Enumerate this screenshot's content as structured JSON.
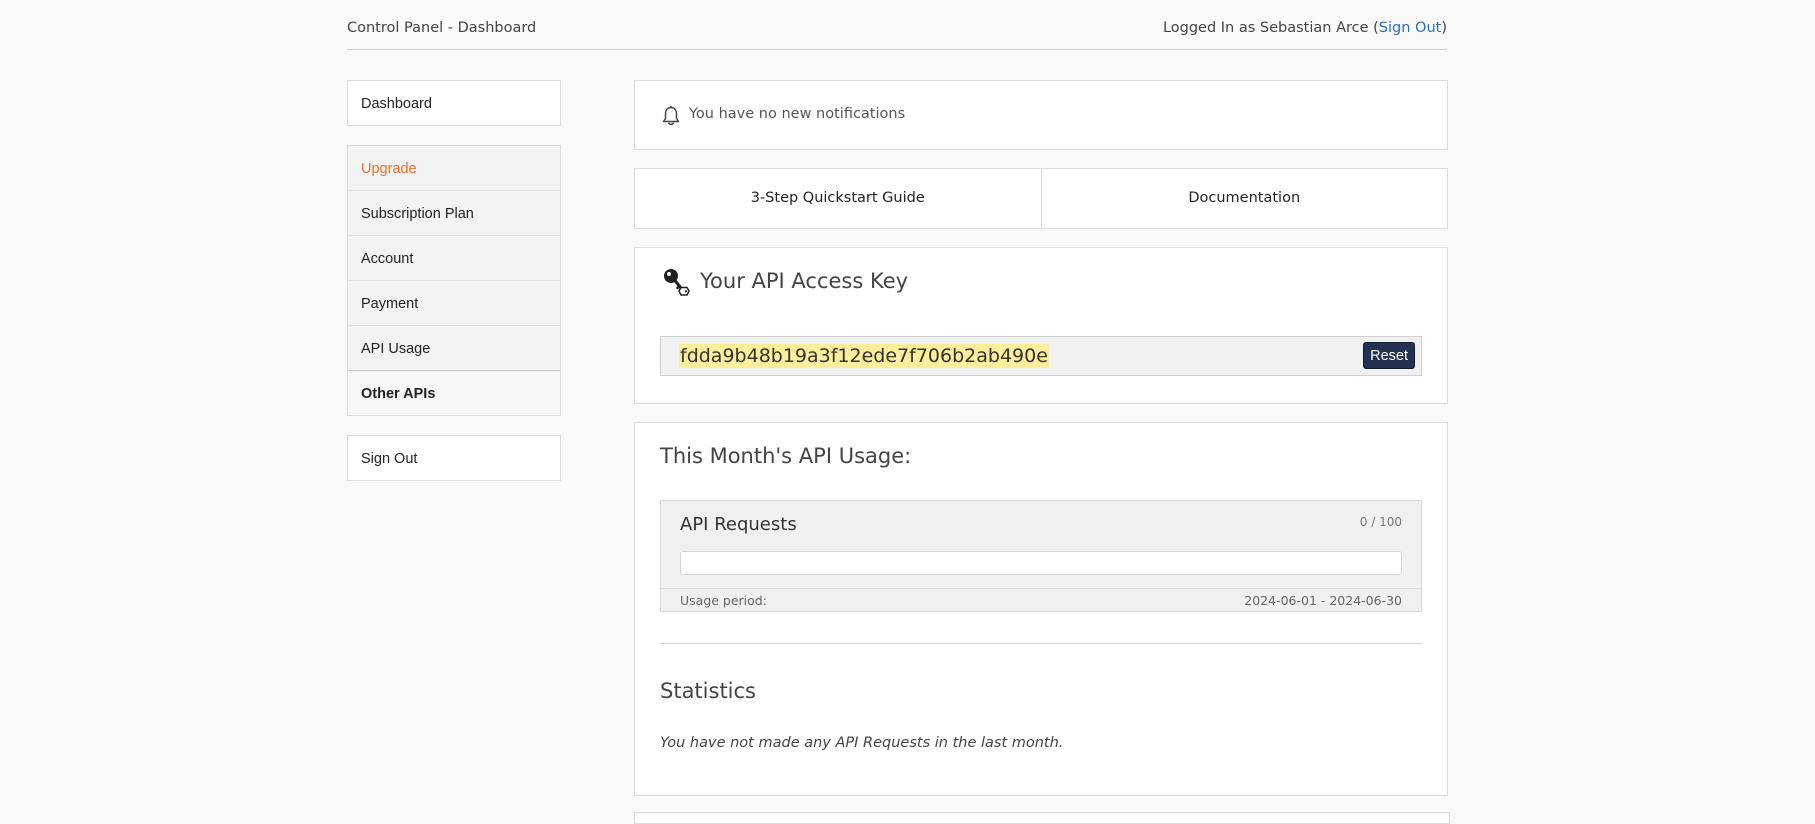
{
  "header": {
    "title": "Control Panel - Dashboard",
    "logged_in_prefix": "Logged In as Sebastian Arce (",
    "sign_out_link": "Sign Out",
    "logged_in_suffix": ")"
  },
  "sidebar": {
    "dashboard": "Dashboard",
    "items": [
      {
        "label": "Upgrade",
        "color": "#e57230"
      },
      {
        "label": "Subscription Plan"
      },
      {
        "label": "Account"
      },
      {
        "label": "Payment"
      },
      {
        "label": "API Usage"
      },
      {
        "label": "Other APIs"
      }
    ],
    "sign_out": "Sign Out"
  },
  "notifications": {
    "icon": "bell-icon",
    "text": "You have no new notifications"
  },
  "guides": {
    "quickstart": "3-Step Quickstart Guide",
    "documentation": "Documentation"
  },
  "api_key": {
    "icon": "key-icon",
    "heading": "Your API Access Key",
    "value": "fdda9b48b19a3f12ede7f706b2ab490e",
    "reset_label": "Reset"
  },
  "usage": {
    "heading": "This Month's API Usage:",
    "requests_label": "API Requests",
    "count_text": "0 / 100",
    "used": 0,
    "limit": 100,
    "period_label": "Usage period:",
    "period_value": "2024-06-01 - 2024-06-30",
    "statistics_heading": "Statistics",
    "statistics_note": "You have not made any API Requests in the last month."
  },
  "colors": {
    "accent_link": "#2d6fb6",
    "upgrade": "#e57230",
    "reset_button": "#223250",
    "key_highlight": "#fdef9a"
  }
}
